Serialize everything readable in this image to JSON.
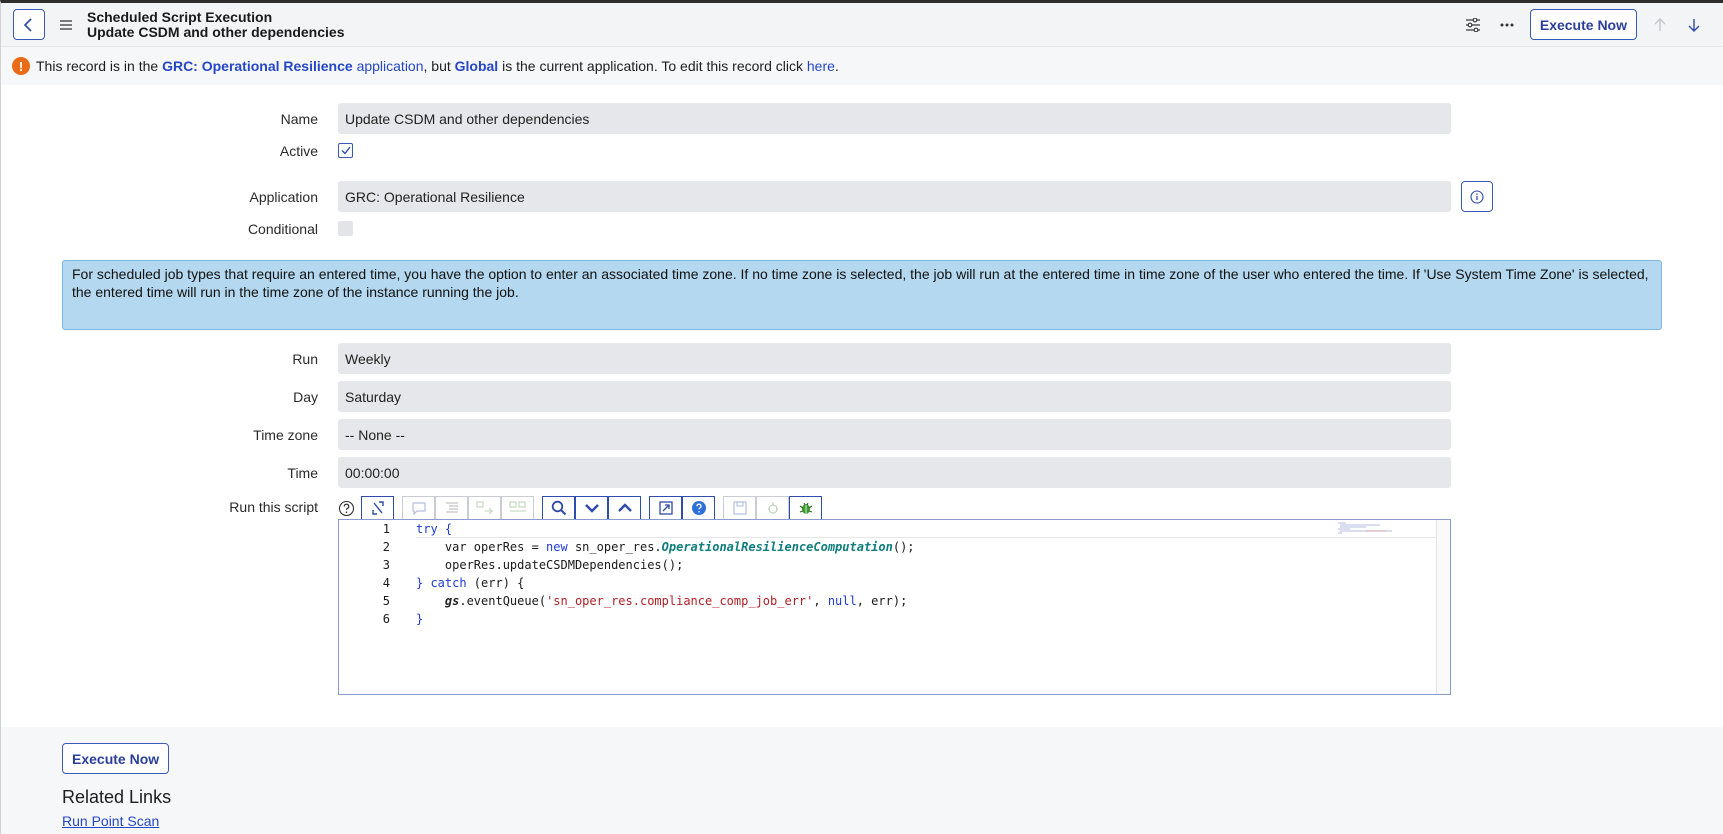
{
  "header": {
    "title": "Scheduled Script Execution",
    "subtitle": "Update CSDM and other dependencies",
    "execute_label": "Execute Now",
    "icons": [
      "back-icon",
      "menu-icon",
      "settings-sliders-icon",
      "more-icon",
      "arrow-up-icon",
      "arrow-down-icon"
    ]
  },
  "infobar": {
    "prefix": "This record is in the",
    "app_link": "GRC: Operational Resilience",
    "app_word": "application",
    "middle": ", but",
    "global_link": "Global",
    "suffix": "is the current application. To edit this record click",
    "here_link": "here",
    "end": "."
  },
  "form": {
    "name_label": "Name",
    "name_value": "Update CSDM and other dependencies",
    "active_label": "Active",
    "active_checked": true,
    "application_label": "Application",
    "application_value": "GRC: Operational Resilience",
    "conditional_label": "Conditional",
    "conditional_checked": false,
    "notice": "For scheduled job types that require an entered time, you have the option to enter an associated time zone. If no time zone is selected, the job will run at the entered time in time zone of the user who entered the time. If 'Use System Time Zone' is selected, the entered time will run in the time zone of the instance running the job.",
    "run_label": "Run",
    "run_value": "Weekly",
    "day_label": "Day",
    "day_value": "Saturday",
    "timezone_label": "Time zone",
    "timezone_value": "-- None --",
    "time_label": "Time",
    "time_value": "00:00:00",
    "script_label": "Run this script"
  },
  "script": {
    "line_numbers": [
      "1",
      "2",
      "3",
      "4",
      "5",
      "6"
    ],
    "l1_kw": "try",
    "l1_rest": " {",
    "l2_a": "    var operRes = ",
    "l2_kw": "new",
    "l2_b": " sn_oper_res.",
    "l2_cls": "OperationalResilienceComputation",
    "l2_c": "();",
    "l3": "    operRes.updateCSDMDependencies();",
    "l4_a": "} ",
    "l4_kw": "catch",
    "l4_b": " (err) {",
    "l5_gs": "gs",
    "l5_a": ".eventQueue(",
    "l5_str": "'sn_oper_res.compliance_comp_job_err'",
    "l5_b": ", ",
    "l5_null": "null",
    "l5_c": ", err);",
    "l6": "}"
  },
  "footer": {
    "execute_label": "Execute Now",
    "related_title": "Related Links",
    "run_point_scan": "Run Point Scan"
  },
  "colors": {
    "accent": "#2b3f9a",
    "link": "#2547c5",
    "warning": "#e96b17",
    "notice_bg": "#b4d8ef",
    "field_bg": "#e6e7ea"
  }
}
